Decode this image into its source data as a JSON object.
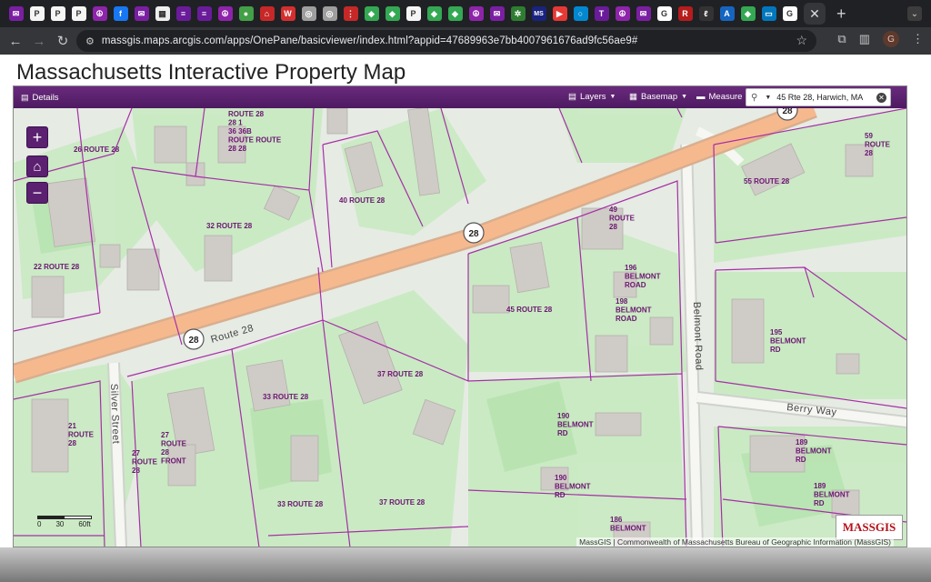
{
  "browser": {
    "tab_favicons": [
      {
        "icon": "mail-icon",
        "color": "#7b1fa2",
        "glyph": "✉"
      },
      {
        "icon": "p-icon",
        "color": "#f5f5f5",
        "glyph": "P"
      },
      {
        "icon": "p-icon",
        "color": "#f5f5f5",
        "glyph": "P"
      },
      {
        "icon": "p-icon",
        "color": "#f5f5f5",
        "glyph": "P"
      },
      {
        "icon": "peace-icon",
        "color": "#8e24aa",
        "glyph": "☮"
      },
      {
        "icon": "facebook-icon",
        "color": "#1877f2",
        "glyph": "f"
      },
      {
        "icon": "mail-icon",
        "color": "#7b1fa2",
        "glyph": "✉"
      },
      {
        "icon": "grid-icon",
        "color": "#eeeeee",
        "glyph": "▦"
      },
      {
        "icon": "list-icon",
        "color": "#6a1b9a",
        "glyph": "≡"
      },
      {
        "icon": "list-icon",
        "color": "#6a1b9a",
        "glyph": "≡"
      },
      {
        "icon": "peace-icon",
        "color": "#8e24aa",
        "glyph": "☮"
      },
      {
        "icon": "circle-icon",
        "color": "#43a047",
        "glyph": "●"
      },
      {
        "icon": "home-red-icon",
        "color": "#c62828",
        "glyph": "⌂"
      },
      {
        "icon": "w-icon",
        "color": "#d32f2f",
        "glyph": "W"
      },
      {
        "icon": "globe-icon",
        "color": "#9e9e9e",
        "glyph": "◎"
      },
      {
        "icon": "globe-icon",
        "color": "#9e9e9e",
        "glyph": "◎"
      },
      {
        "icon": "dot-icon",
        "color": "#c62828",
        "glyph": "⋮"
      },
      {
        "icon": "maps-icon",
        "color": "#34a853",
        "glyph": "◆"
      },
      {
        "icon": "maps-icon",
        "color": "#34a853",
        "glyph": "◆"
      },
      {
        "icon": "p-icon",
        "color": "#f5f5f5",
        "glyph": "P"
      },
      {
        "icon": "maps-icon",
        "color": "#34a853",
        "glyph": "◆"
      },
      {
        "icon": "maps-icon",
        "color": "#34a853",
        "glyph": "◆"
      },
      {
        "icon": "peace-icon",
        "color": "#8e24aa",
        "glyph": "☮"
      },
      {
        "icon": "mail-icon",
        "color": "#7b1fa2",
        "glyph": "✉"
      },
      {
        "icon": "gear-icon",
        "color": "#2e7d32",
        "glyph": "✲"
      },
      {
        "icon": "ms-icon",
        "color": "#1a237e",
        "glyph": "MS"
      },
      {
        "icon": "youtube-icon",
        "color": "#e53935",
        "glyph": "▶"
      },
      {
        "icon": "ring-icon",
        "color": "#0288d1",
        "glyph": "○"
      },
      {
        "icon": "t-icon",
        "color": "#6a1b9a",
        "glyph": "T"
      },
      {
        "icon": "peace-icon",
        "color": "#8e24aa",
        "glyph": "☮"
      },
      {
        "icon": "mail-icon",
        "color": "#7b1fa2",
        "glyph": "✉"
      },
      {
        "icon": "google-icon",
        "color": "#ffffff",
        "glyph": "G"
      },
      {
        "icon": "r-icon",
        "color": "#b71c1c",
        "glyph": "R"
      },
      {
        "icon": "lexus-icon",
        "color": "#333333",
        "glyph": "ℓ"
      },
      {
        "icon": "a-icon",
        "color": "#1565c0",
        "glyph": "A"
      },
      {
        "icon": "maps-icon",
        "color": "#34a853",
        "glyph": "◆"
      },
      {
        "icon": "image-icon",
        "color": "#0277bd",
        "glyph": "▭"
      },
      {
        "icon": "google-icon",
        "color": "#ffffff",
        "glyph": "G"
      }
    ],
    "active_tab_close": "✕",
    "new_tab": "+",
    "url": "massgis.maps.arcgis.com/apps/OnePane/basicviewer/index.html?appid=47689963e7bb4007961676ad9fc56ae9#",
    "profile_initial": "G"
  },
  "page": {
    "title": "Massachusetts Interactive Property Map"
  },
  "app": {
    "details_label": "Details",
    "layers_label": "Layers",
    "basemap_label": "Basemap",
    "measure_label": "Measure",
    "search_value": "45 Rte 28, Harwich, MA",
    "zoom_in": "+",
    "zoom_out": "−",
    "home": "⌂",
    "scale_labels": [
      "0",
      "30",
      "60ft"
    ],
    "attribution": "MassGIS | Commonwealth of Massachusetts Bureau of Geographic Information (MassGIS)",
    "logo_text": "MASSGIS"
  },
  "map": {
    "road_labels": [
      "Route 28",
      "Silver Street",
      "Belmont Road",
      "Berry Way"
    ],
    "shield_number": "28",
    "parcel_labels": [
      [
        "ROUTE 28",
        "28 1",
        "36 36B",
        "ROUTE ROUTE",
        "28 28"
      ],
      [
        "26 ROUTE 28"
      ],
      [
        "40 ROUTE 28"
      ],
      [
        "32 ROUTE 28"
      ],
      [
        "22 ROUTE 28"
      ],
      [
        "49",
        "ROUTE",
        "28"
      ],
      [
        "59",
        "ROUTE",
        "28"
      ],
      [
        "55 ROUTE 28"
      ],
      [
        "196",
        "BELMONT",
        "ROAD"
      ],
      [
        "198",
        "BELMONT",
        "ROAD"
      ],
      [
        "45 ROUTE 28"
      ],
      [
        "195",
        "BELMONT",
        "RD"
      ],
      [
        "37 ROUTE 28"
      ],
      [
        "33 ROUTE 28"
      ],
      [
        "190",
        "BELMONT",
        "RD"
      ],
      [
        "189",
        "BELMONT",
        "RD"
      ],
      [
        "189",
        "BELMONT",
        "RD"
      ],
      [
        "21",
        "ROUTE",
        "28"
      ],
      [
        "27",
        "ROUTE",
        "28",
        "FRONT"
      ],
      [
        "27",
        "ROUTE",
        "28"
      ],
      [
        "190",
        "BELMONT",
        "RD"
      ],
      [
        "33 ROUTE 28"
      ],
      [
        "37 ROUTE 28"
      ],
      [
        "186",
        "BELMONT"
      ]
    ]
  }
}
